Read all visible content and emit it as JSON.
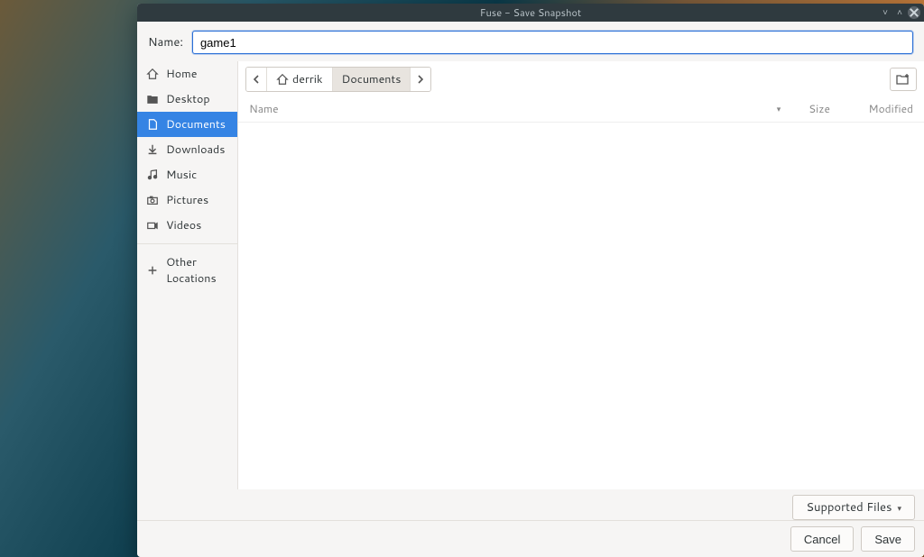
{
  "window": {
    "title": "Fuse - Save Snapshot"
  },
  "name_field": {
    "label": "Name:",
    "value": "game1"
  },
  "sidebar": {
    "items": [
      {
        "label": "Home"
      },
      {
        "label": "Desktop"
      },
      {
        "label": "Documents",
        "active": true
      },
      {
        "label": "Downloads"
      },
      {
        "label": "Music"
      },
      {
        "label": "Pictures"
      },
      {
        "label": "Videos"
      }
    ],
    "other_locations": "Other Locations"
  },
  "breadcrumb": {
    "home_label": "derrik",
    "current": "Documents"
  },
  "columns": {
    "name": "Name",
    "size": "Size",
    "modified": "Modified"
  },
  "filter": {
    "label": "Supported Files"
  },
  "buttons": {
    "cancel": "Cancel",
    "save": "Save"
  }
}
